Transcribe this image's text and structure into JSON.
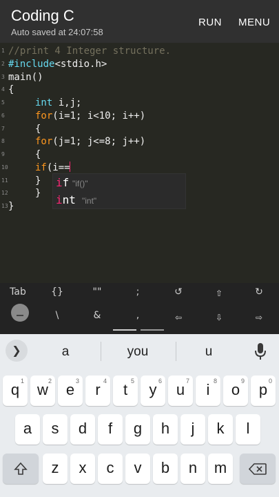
{
  "header": {
    "title": "Coding C",
    "subtitle": "Auto saved at 24:07:58",
    "run_label": "RUN",
    "menu_label": "MENU"
  },
  "editor": {
    "line_numbers": [
      "1",
      "2",
      "3",
      "4",
      "5",
      "6",
      "7",
      "8",
      "9",
      "10",
      "11",
      "12",
      "13"
    ],
    "lines": {
      "l1": "//print 4 Integer structure.",
      "l2_kw": "#include",
      "l2_rest": "<stdio.h>",
      "l3": "main()",
      "l4": "{",
      "l5_kw": "int",
      "l5_rest": " i,j;",
      "l6_kw": "for",
      "l6_rest": "(i=1; i<10; i++)",
      "l7": "{",
      "l8_kw": "for",
      "l8_rest": "(j=1; j<=8; j++)",
      "l9": "{",
      "l10_kw": "if",
      "l10_rest": "(i==",
      "l11": "}",
      "l12": "}",
      "l13": "}"
    },
    "suggestions": [
      {
        "match": "i",
        "rest": "f",
        "hint": "\"if()\""
      },
      {
        "match": "i",
        "rest": "nt",
        "hint": "\"int\""
      }
    ],
    "colors": {
      "background": "#272822",
      "keyword": "#fd971f",
      "preprocessor": "#66d9ef",
      "cursor": "#f92672"
    }
  },
  "symbol_bar": {
    "row1": [
      "Tab",
      "{}",
      "\"\"",
      ";",
      "↺",
      "⇧",
      "↻"
    ],
    "row2": [
      "\\",
      "&",
      ",",
      "⇦",
      "⇩",
      "⇨"
    ]
  },
  "keyboard": {
    "suggestions": [
      "a",
      "you",
      "u"
    ],
    "expand_icon": "chevron-right-icon",
    "row1": [
      {
        "k": "q",
        "h": "1"
      },
      {
        "k": "w",
        "h": "2"
      },
      {
        "k": "e",
        "h": "3"
      },
      {
        "k": "r",
        "h": "4"
      },
      {
        "k": "t",
        "h": "5"
      },
      {
        "k": "y",
        "h": "6"
      },
      {
        "k": "u",
        "h": "7"
      },
      {
        "k": "i",
        "h": "8"
      },
      {
        "k": "o",
        "h": "9"
      },
      {
        "k": "p",
        "h": "0"
      }
    ],
    "row2": [
      "a",
      "s",
      "d",
      "f",
      "g",
      "h",
      "j",
      "k",
      "l"
    ],
    "row3": [
      "z",
      "x",
      "c",
      "v",
      "b",
      "n",
      "m"
    ]
  }
}
